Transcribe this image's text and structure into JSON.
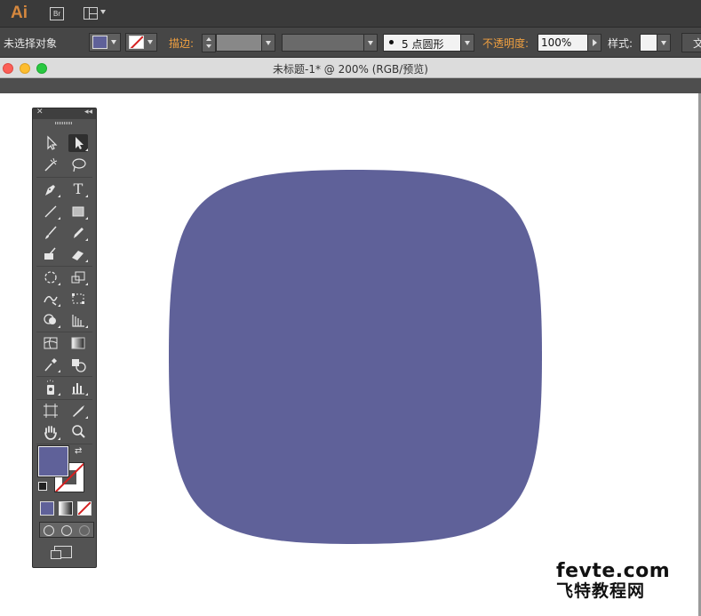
{
  "menubar": {
    "app_logo": "Ai",
    "bridge_label": "Br",
    "workspace_icon": "workspace-layout-icon"
  },
  "control_bar": {
    "selection_status": "未选择对象",
    "fill_color": "#5f6199",
    "stroke_label": "描边:",
    "brush_label": "5 点圆形",
    "opacity_label": "不透明度:",
    "opacity_value": "100%",
    "style_label": "样式:",
    "doc_setup_partial": "文"
  },
  "document": {
    "title": "未标题-1* @ 200% (RGB/预览)"
  },
  "canvas": {
    "shape_color": "#5f6199"
  },
  "toolbar": {
    "tools": [
      {
        "name": "selection-tool",
        "icon": "arrow-outline"
      },
      {
        "name": "direct-selection-tool",
        "icon": "arrow-solid"
      },
      {
        "name": "magic-wand-tool",
        "icon": "magic-wand"
      },
      {
        "name": "lasso-tool",
        "icon": "lasso"
      },
      {
        "name": "pen-tool",
        "icon": "pen"
      },
      {
        "name": "type-tool",
        "icon": "T"
      },
      {
        "name": "line-tool",
        "icon": "line"
      },
      {
        "name": "rectangle-tool",
        "icon": "rectangle"
      },
      {
        "name": "paintbrush-tool",
        "icon": "brush"
      },
      {
        "name": "pencil-tool",
        "icon": "pencil"
      },
      {
        "name": "blob-brush-tool",
        "icon": "blob-brush"
      },
      {
        "name": "eraser-tool",
        "icon": "eraser"
      },
      {
        "name": "rotate-tool",
        "icon": "rotate"
      },
      {
        "name": "scale-tool",
        "icon": "scale"
      },
      {
        "name": "warp-tool",
        "icon": "warp"
      },
      {
        "name": "free-transform-tool",
        "icon": "free-transform"
      },
      {
        "name": "shape-builder-tool",
        "icon": "shape-builder"
      },
      {
        "name": "perspective-grid-tool",
        "icon": "perspective-grid"
      },
      {
        "name": "mesh-tool",
        "icon": "mesh"
      },
      {
        "name": "gradient-tool",
        "icon": "gradient"
      },
      {
        "name": "eyedropper-tool",
        "icon": "eyedropper"
      },
      {
        "name": "blend-tool",
        "icon": "blend"
      },
      {
        "name": "symbol-sprayer-tool",
        "icon": "symbol-sprayer"
      },
      {
        "name": "column-graph-tool",
        "icon": "column-graph"
      },
      {
        "name": "artboard-tool",
        "icon": "artboard"
      },
      {
        "name": "slice-tool",
        "icon": "slice"
      },
      {
        "name": "hand-tool",
        "icon": "hand"
      },
      {
        "name": "zoom-tool",
        "icon": "zoom"
      }
    ],
    "fill_swatch_color": "#5f6199",
    "stroke_swatch": "none"
  },
  "watermark": {
    "line1": "fevte.com",
    "line2": "飞特教程网"
  }
}
